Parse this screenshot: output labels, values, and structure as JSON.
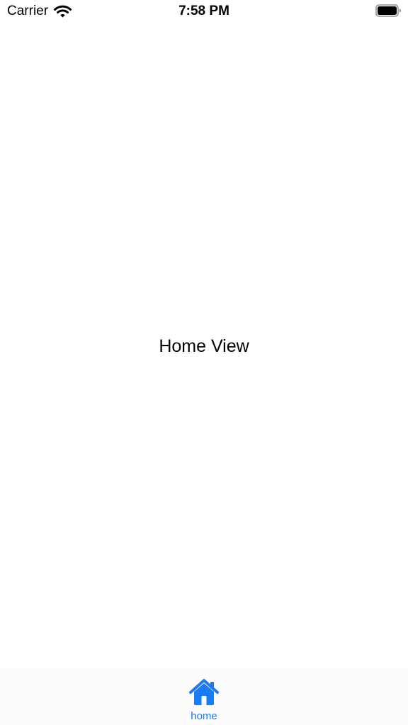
{
  "status_bar": {
    "carrier": "Carrier",
    "time": "7:58 PM",
    "wifi_icon": "wifi-icon",
    "battery_icon": "battery-full-icon"
  },
  "main": {
    "title": "Home View"
  },
  "tab_bar": {
    "items": [
      {
        "label": "home",
        "icon": "house-fill-icon",
        "selected": true
      }
    ]
  },
  "colors": {
    "accent": "#1a7bf2",
    "background": "#ffffff",
    "tab_bar_background": "#fcfcfc"
  }
}
